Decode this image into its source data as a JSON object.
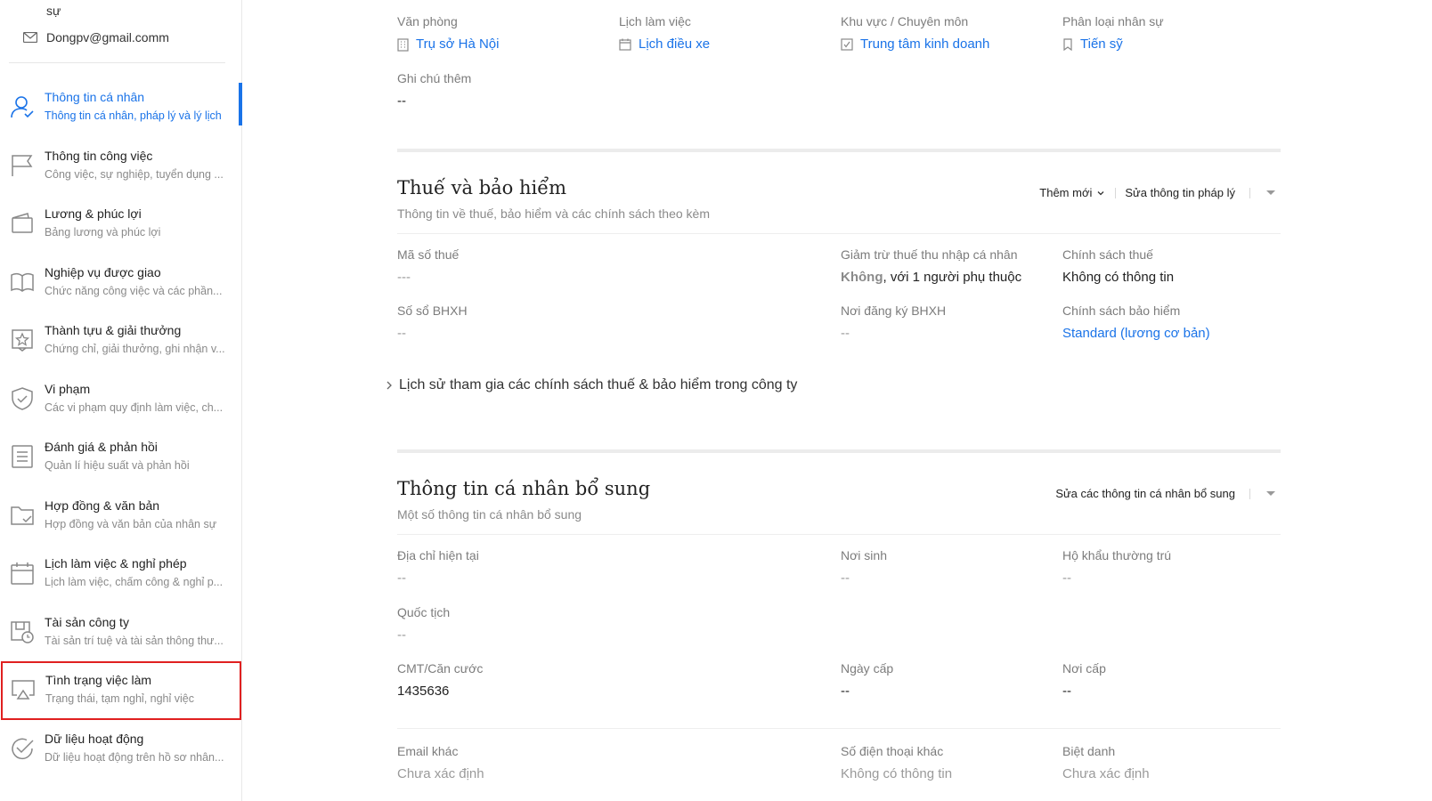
{
  "sidebar": {
    "top_fragment": "sự",
    "email": "Dongpv@gmail.comm",
    "items": [
      {
        "title": "Thông tin cá nhân",
        "sub": "Thông tin cá nhân, pháp lý và lý lịch",
        "icon": "user-check-icon"
      },
      {
        "title": "Thông tin công việc",
        "sub": "Công việc, sự nghiệp, tuyển dụng ...",
        "icon": "flag-icon"
      },
      {
        "title": "Lương & phúc lợi",
        "sub": "Bảng lương và phúc lợi",
        "icon": "wallet-icon"
      },
      {
        "title": "Nghiệp vụ được giao",
        "sub": "Chức năng công việc và các phần...",
        "icon": "book-icon"
      },
      {
        "title": "Thành tựu & giải thưởng",
        "sub": "Chứng chỉ, giải thưởng, ghi nhận v...",
        "icon": "star-badge-icon"
      },
      {
        "title": "Vi phạm",
        "sub": "Các vi phạm quy định làm việc, ch...",
        "icon": "shield-icon"
      },
      {
        "title": "Đánh giá & phản hồi",
        "sub": "Quản lí hiệu suất và phản hồi",
        "icon": "document-list-icon"
      },
      {
        "title": "Hợp đồng & văn bản",
        "sub": "Hợp đồng và văn bản của nhân sự",
        "icon": "folder-check-icon"
      },
      {
        "title": "Lịch làm việc & nghỉ phép",
        "sub": "Lịch làm việc, chấm công & nghỉ p...",
        "icon": "calendar-icon"
      },
      {
        "title": "Tài sản công ty",
        "sub": "Tài sản trí tuệ và tài sản thông thư...",
        "icon": "asset-clock-icon"
      },
      {
        "title": "Tình trạng việc làm",
        "sub": "Trạng thái, tạm nghỉ, nghỉ việc",
        "icon": "airplay-icon"
      },
      {
        "title": "Dữ liệu hoạt động",
        "sub": "Dữ liệu hoạt động trên hồ sơ nhân...",
        "icon": "check-circle-icon"
      }
    ]
  },
  "work_info": {
    "office_label": "Văn phòng",
    "office_value": "Trụ sở Hà Nội",
    "schedule_label": "Lịch làm việc",
    "schedule_value": "Lịch điều xe",
    "area_label": "Khu vực / Chuyên môn",
    "area_value": "Trung tâm kinh doanh",
    "class_label": "Phân loại nhân sự",
    "class_value": "Tiến sỹ",
    "note_label": "Ghi chú thêm",
    "note_value": "--"
  },
  "tax": {
    "title": "Thuế và bảo hiểm",
    "subtitle": "Thông tin về thuế, bảo hiểm và các chính sách theo kèm",
    "add_label": "Thêm mới",
    "edit_label": "Sửa thông tin pháp lý",
    "tax_code_label": "Mã số thuế",
    "tax_code_value": "---",
    "deduction_label": "Giảm trừ thuế thu nhập cá nhân",
    "deduction_strong": "Không",
    "deduction_rest": ", với 1 người phụ thuộc",
    "tax_policy_label": "Chính sách thuế",
    "tax_policy_value": "Không có thông tin",
    "bhxh_label": "Số sổ BHXH",
    "bhxh_value": "--",
    "bhxh_place_label": "Nơi đăng ký BHXH",
    "bhxh_place_value": "--",
    "ins_policy_label": "Chính sách bảo hiểm",
    "ins_policy_value": "Standard (lương cơ bản)",
    "history_label": "Lịch sử tham gia các chính sách thuế & bảo hiểm trong công ty"
  },
  "extra": {
    "title": "Thông tin cá nhân bổ sung",
    "subtitle": "Một số thông tin cá nhân bổ sung",
    "edit_label": "Sửa các thông tin cá nhân bổ sung",
    "address_label": "Địa chỉ hiện tại",
    "address_value": "--",
    "birthplace_label": "Nơi sinh",
    "birthplace_value": "--",
    "household_label": "Hộ khẩu thường trú",
    "household_value": "--",
    "nationality_label": "Quốc tịch",
    "nationality_value": "--",
    "id_label": "CMT/Căn cước",
    "id_value": "1435636",
    "issue_date_label": "Ngày cấp",
    "issue_date_value": "--",
    "issue_place_label": "Nơi cấp",
    "issue_place_value": "--",
    "email2_label": "Email khác",
    "email2_value": "Chưa xác định",
    "phone2_label": "Số điện thoại khác",
    "phone2_value": "Không có thông tin",
    "nickname_label": "Biệt danh",
    "nickname_value": "Chưa xác định"
  },
  "colors": {
    "accent": "#1a73e8",
    "highlight": "#e02020"
  }
}
